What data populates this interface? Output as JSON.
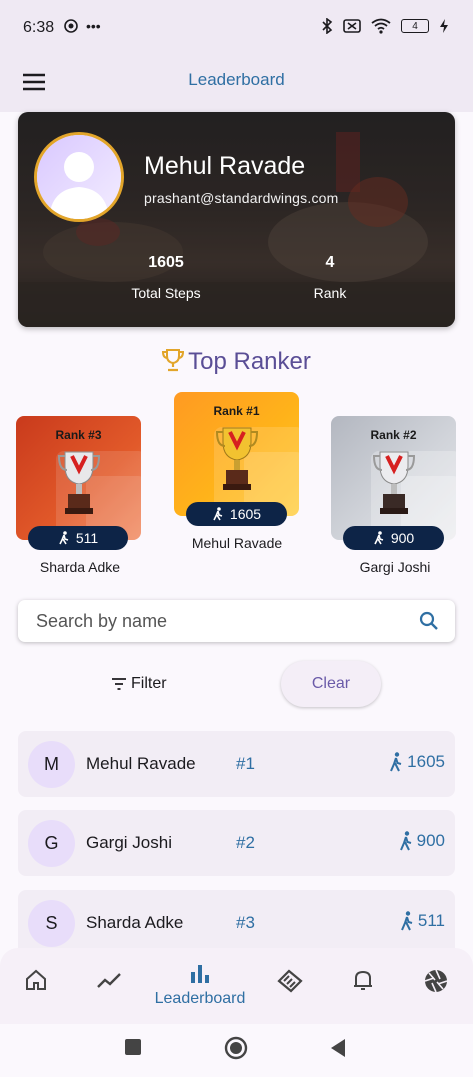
{
  "status": {
    "time": "6:38",
    "battery": "4"
  },
  "app_bar": {
    "title": "Leaderboard"
  },
  "profile": {
    "name": "Mehul Ravade",
    "email": "prashant@standardwings.com",
    "steps_value": "1605",
    "steps_label": "Total Steps",
    "rank_value": "4",
    "rank_label": "Rank"
  },
  "top_ranker": {
    "title": "Top Ranker"
  },
  "podium": {
    "first": {
      "rank_label": "Rank #1",
      "steps": "1605",
      "name": "Mehul Ravade"
    },
    "second": {
      "rank_label": "Rank #2",
      "steps": "900",
      "name": "Gargi Joshi"
    },
    "third": {
      "rank_label": "Rank #3",
      "steps": "511",
      "name": "Sharda Adke"
    }
  },
  "search": {
    "placeholder": "Search by name"
  },
  "controls": {
    "filter_label": "Filter",
    "clear_label": "Clear"
  },
  "leaderboard": [
    {
      "initial": "M",
      "name": "Mehul Ravade",
      "rank": "#1",
      "steps": "1605"
    },
    {
      "initial": "G",
      "name": "Gargi Joshi",
      "rank": "#2",
      "steps": "900"
    },
    {
      "initial": "S",
      "name": "Sharda Adke",
      "rank": "#3",
      "steps": "511"
    }
  ],
  "bottom_nav": {
    "items": [
      "home-icon",
      "trending-icon",
      "leaderboard-icon",
      "handshake-icon",
      "bell-icon",
      "aperture-icon"
    ],
    "active_label": "Leaderboard"
  },
  "colors": {
    "accent": "#2f6fa3",
    "pill": "#0d2447",
    "gold": "#e2a52a",
    "ranker_title": "#5a4e96"
  }
}
